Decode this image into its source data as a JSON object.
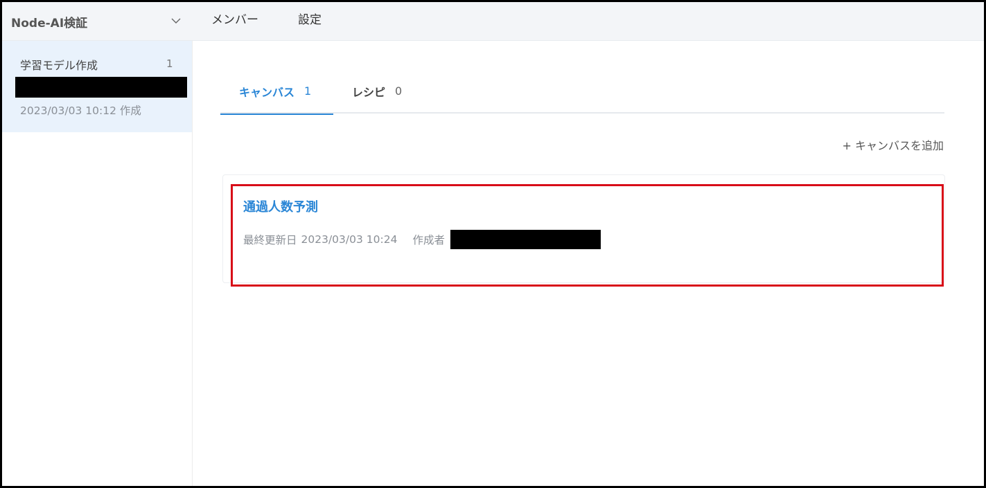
{
  "header": {
    "workspace_name": "Node-AI検証",
    "nav": [
      "メンバー",
      "設定"
    ]
  },
  "sidebar": {
    "project": {
      "title": "学習モデル作成",
      "count": "1",
      "created": "2023/03/03 10:12 作成"
    }
  },
  "tabs": [
    {
      "label": "キャンバス",
      "count": "1",
      "active": true
    },
    {
      "label": "レシピ",
      "count": "0",
      "active": false
    }
  ],
  "actions": {
    "add_canvas": "+ キャンバスを追加"
  },
  "canvas": {
    "title": "通過人数予測",
    "updated_label": "最終更新日",
    "updated": "2023/03/03 10:24",
    "author_label": "作成者"
  },
  "colors": {
    "accent": "#2a86d6",
    "highlight": "#d80c18",
    "sidebar_active": "#e9f2fc"
  }
}
